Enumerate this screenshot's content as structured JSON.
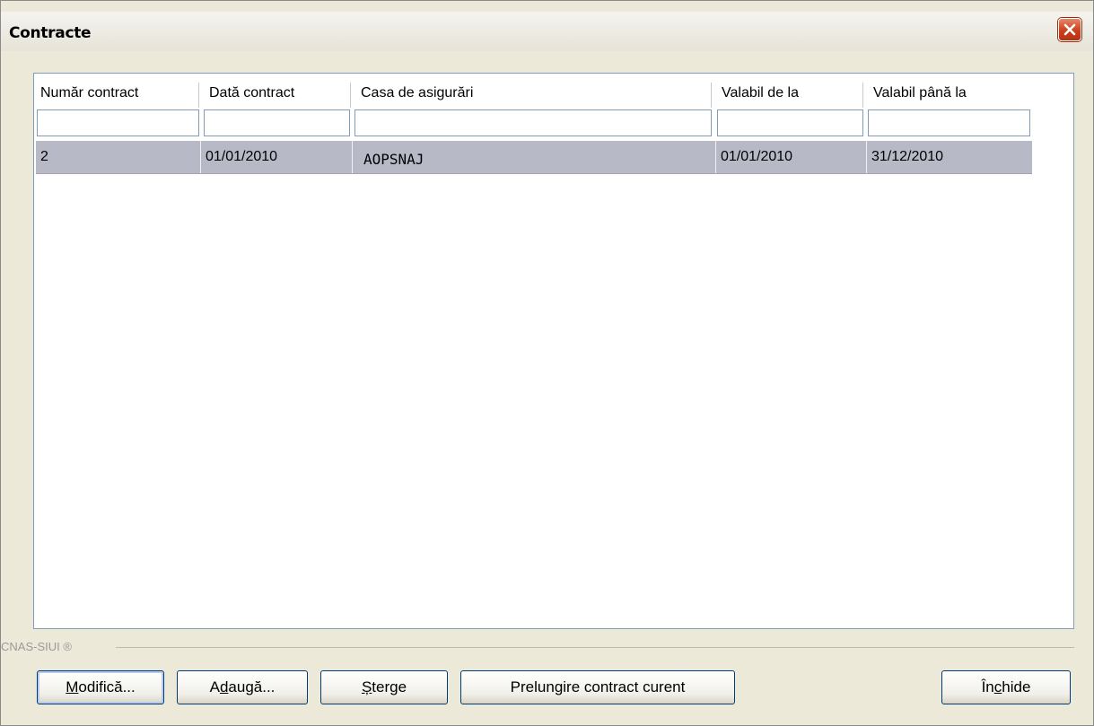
{
  "window": {
    "title": "Contracte"
  },
  "table": {
    "columns": [
      "Număr contract",
      "Dată contract",
      "Casa de asigurări",
      "Valabil de la",
      "Valabil până la"
    ],
    "rows": [
      [
        "2",
        "01/01/2010",
        "AOPSNAJ",
        "01/01/2010",
        "31/12/2010"
      ]
    ]
  },
  "footer": {
    "brand": "CNAS-SIUI ®"
  },
  "buttons": {
    "modify": {
      "pre": "",
      "u": "M",
      "post": "odifică..."
    },
    "add": {
      "pre": "A",
      "u": "d",
      "post": "augă..."
    },
    "delete": {
      "pre": "",
      "u": "Ș",
      "post": "terge"
    },
    "extend": {
      "label": "Prelungire contract curent"
    },
    "close": {
      "pre": "În",
      "u": "c",
      "post": "hide"
    }
  }
}
